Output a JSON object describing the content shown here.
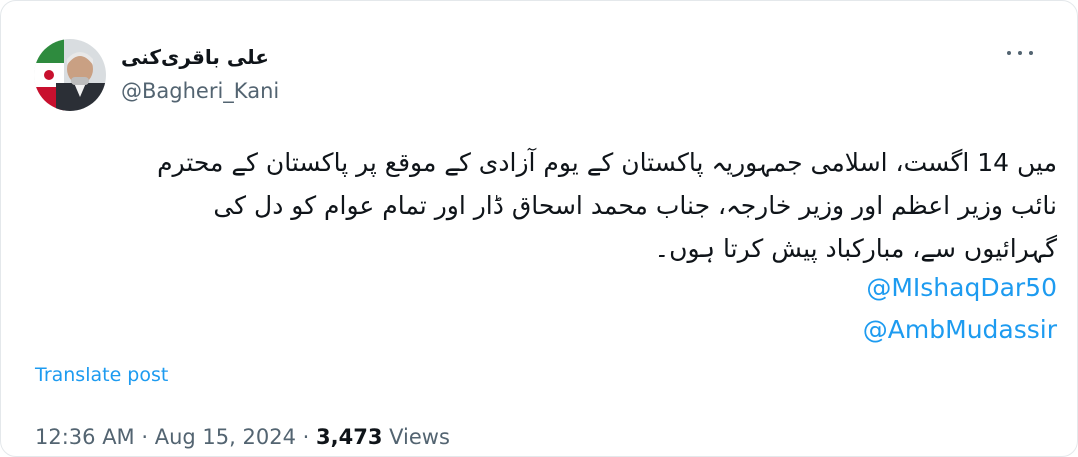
{
  "author": {
    "display_name": "علی باقری‌کنی",
    "handle": "@Bagheri_Kani"
  },
  "menu_icon": "more-horizontal-icon",
  "post": {
    "lines": [
      "میں 14 اگست، اسلامی جمہوریہ پاکستان کے یوم آزادی کے موقع پر پاکستان کے محترم",
      "نائب وزیر اعظم اور وزیر خارجہ، جناب محمد اسحاق ڈار اور تمام عوام کو دل کی",
      "گہرائیوں سے، مبارکباد پیش کرتا ہوں۔"
    ],
    "mentions": [
      "@MIshaqDar50",
      "@AmbMudassir"
    ]
  },
  "translate_label": "Translate post",
  "meta": {
    "time": "12:36 AM",
    "separator": "·",
    "date": "Aug 15, 2024",
    "views_count": "3,473",
    "views_label": "Views"
  },
  "colors": {
    "link": "#1d9bf0",
    "secondary_text": "#536471",
    "primary_text": "#0f1419"
  }
}
